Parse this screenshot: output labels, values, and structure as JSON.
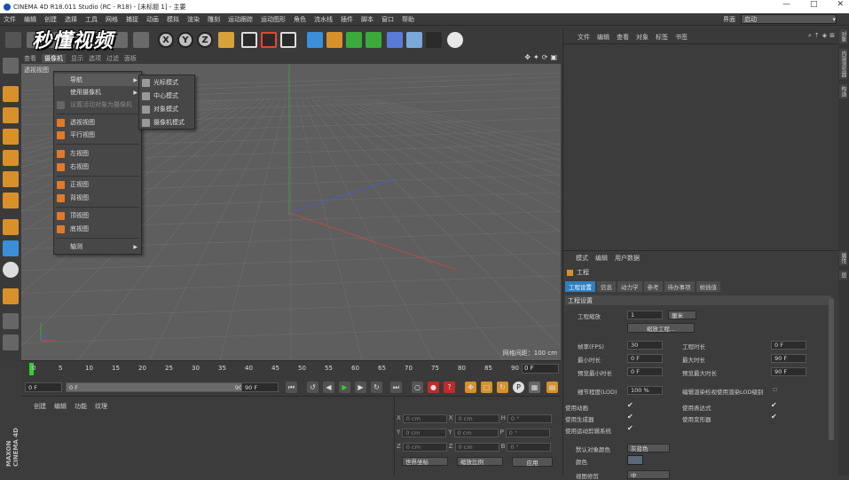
{
  "window": {
    "title": "CINEMA 4D R18.011 Studio (RC - R18) - [未标题 1] - 主要",
    "controls": [
      "—",
      "□",
      "✕"
    ]
  },
  "menubar": {
    "items": [
      "文件",
      "编辑",
      "创建",
      "选择",
      "工具",
      "网格",
      "捕捉",
      "动画",
      "模拟",
      "渲染",
      "雕刻",
      "运动跟踪",
      "运动图形",
      "角色",
      "流水线",
      "插件",
      "脚本",
      "窗口",
      "帮助"
    ],
    "layout_label": "界面",
    "layout_value": "启动"
  },
  "watermark": "秒懂视频",
  "toolbar": {
    "axis_x": "X",
    "axis_y": "Y",
    "axis_z": "Z"
  },
  "viewport": {
    "tabs": [
      "查看",
      "摄像机",
      "显示",
      "选项",
      "过滤",
      "面板"
    ],
    "active_tab": "摄像机",
    "label": "透视视图",
    "grid_spacing": "网格间距：100 cm"
  },
  "camera_menu": {
    "items": [
      {
        "label": "导航",
        "submenu": true
      },
      {
        "label": "使用摄像机",
        "submenu": true
      },
      {
        "label": "设置活动对象为摄像机",
        "disabled": true
      },
      {
        "label": "透视视图"
      },
      {
        "label": "平行视图"
      },
      {
        "label": "左视图"
      },
      {
        "label": "右视图"
      },
      {
        "label": "正视图"
      },
      {
        "label": "背视图"
      },
      {
        "label": "顶视图"
      },
      {
        "label": "底视图"
      },
      {
        "label": "轴测",
        "submenu": true
      }
    ]
  },
  "nav_submenu": {
    "items": [
      "光标模式",
      "中心模式",
      "对象模式",
      "摄像机模式"
    ]
  },
  "timeline": {
    "ticks": [
      "0",
      "5",
      "10",
      "15",
      "20",
      "25",
      "30",
      "35",
      "40",
      "45",
      "50",
      "55",
      "60",
      "65",
      "70",
      "75",
      "80",
      "85",
      "90"
    ],
    "end_frame": "0 F"
  },
  "transport": {
    "start_field": "0 F",
    "slider_left": "0 F",
    "slider_right": "90 F",
    "end_field": "90 F"
  },
  "material_panel": {
    "tabs": [
      "创建",
      "编辑",
      "功能",
      "纹理"
    ]
  },
  "brand": "MAXON CINEMA 4D",
  "coords": {
    "rows": [
      {
        "a": "X",
        "av": "0 cm",
        "b": "X",
        "bv": "0 cm",
        "c": "H",
        "cv": "0 °"
      },
      {
        "a": "Y",
        "av": "0 cm",
        "b": "Y",
        "bv": "0 cm",
        "c": "P",
        "cv": "0 °"
      },
      {
        "a": "Z",
        "av": "0 cm",
        "b": "Z",
        "bv": "0 cm",
        "c": "B",
        "cv": "0 °"
      }
    ],
    "mode1": "世界坐标",
    "mode2": "缩放比例",
    "apply": "应用"
  },
  "object_manager": {
    "tabs": [
      "文件",
      "编辑",
      "查看",
      "对象",
      "标签",
      "书签"
    ]
  },
  "right_strip": [
    "对象",
    "内容浏览器",
    "构造",
    "属性",
    "层"
  ],
  "attributes": {
    "header_tabs": [
      "模式",
      "编辑",
      "用户数据"
    ],
    "project_label": "工程",
    "project_tabs": [
      "工程设置",
      "信息",
      "动力学",
      "参考",
      "待办事项",
      "帧插值"
    ],
    "section": "工程设置",
    "scale_label": "工程缩放",
    "scale_value": "1",
    "scale_unit": "厘米",
    "scale_button": "缩放工程...",
    "fields": [
      {
        "label": "帧率(FPS)",
        "value": "30",
        "label2": "工程时长",
        "value2": "0 F"
      },
      {
        "label": "最小时长",
        "value": "0 F",
        "label2": "最大时长",
        "value2": "90 F"
      },
      {
        "label": "预览最小时长",
        "value": "0 F",
        "label2": "预览最大时长",
        "value2": "90 F"
      }
    ],
    "lod_label": "细节程度(LOD)",
    "lod_value": "100 %",
    "lod_label2": "编辑渲染检视使用渲染LOD级别",
    "checks": [
      {
        "label": "使用动画",
        "label2": "使用表达式"
      },
      {
        "label": "使用生成器",
        "label2": "使用变形器"
      },
      {
        "label": "使用运动剪辑系统",
        "label2": ""
      }
    ],
    "default_color_label": "默认对象颜色",
    "default_color_value": "灰蓝色",
    "color_label": "颜色",
    "bottom_label": "视图修剪",
    "bottom_value": "中"
  }
}
